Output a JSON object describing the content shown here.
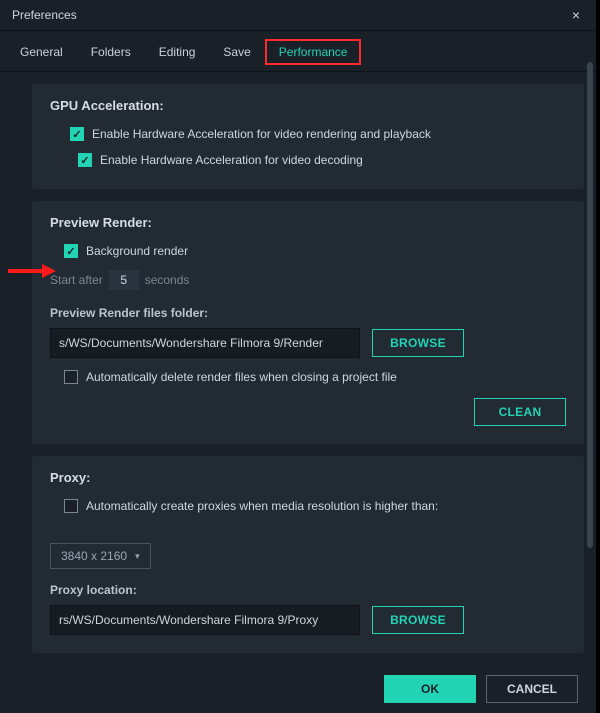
{
  "window": {
    "title": "Preferences"
  },
  "tabs": {
    "general": "General",
    "folders": "Folders",
    "editing": "Editing",
    "save": "Save",
    "performance": "Performance"
  },
  "gpu": {
    "title": "GPU Acceleration:",
    "hw_render": "Enable Hardware Acceleration for video rendering and playback",
    "hw_decode": "Enable Hardware Acceleration for video decoding"
  },
  "preview": {
    "title": "Preview Render:",
    "bg_render": "Background render",
    "start_after": "Start after",
    "start_value": "5",
    "seconds": "seconds",
    "files_folder_label": "Preview Render files folder:",
    "files_folder_path": "s/WS/Documents/Wondershare Filmora 9/Render",
    "browse": "BROWSE",
    "auto_delete": "Automatically delete render files when closing a project file",
    "clean": "CLEAN"
  },
  "proxy": {
    "title": "Proxy:",
    "auto_create": "Automatically create proxies when media resolution is higher than:",
    "resolution_selected": "3840 x 2160",
    "location_label": "Proxy location:",
    "location_path": "rs/WS/Documents/Wondershare Filmora 9/Proxy",
    "browse": "BROWSE"
  },
  "footer": {
    "ok": "OK",
    "cancel": "CANCEL"
  }
}
